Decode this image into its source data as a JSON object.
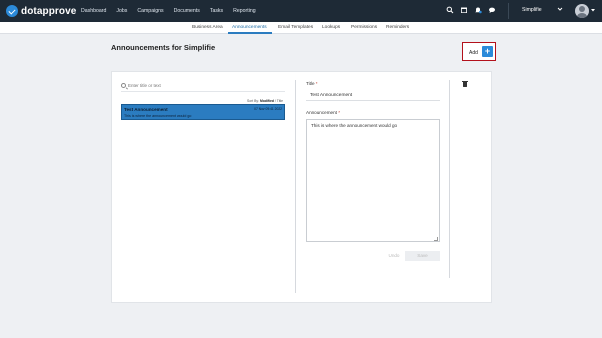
{
  "app": {
    "logo_text": "dotapprove",
    "nav": [
      "Dashboard",
      "Jobs",
      "Campaigns",
      "Documents",
      "Tasks",
      "Reporting"
    ],
    "org_name": "Simplifie"
  },
  "tabs": [
    {
      "label": "Business Area",
      "active": false
    },
    {
      "label": "Announcements",
      "active": true
    },
    {
      "label": "Email Templates",
      "active": false
    },
    {
      "label": "Lookups",
      "active": false
    },
    {
      "label": "Permissions",
      "active": false
    },
    {
      "label": "Reminders",
      "active": false
    }
  ],
  "page": {
    "title": "Announcements for Simplifie",
    "add_label": "Add",
    "add_icon": "+"
  },
  "list": {
    "search_placeholder": "Enter title or text",
    "sort_prefix": "Sort By:",
    "sort_modified": "Modified",
    "sort_sep": "/",
    "sort_title": "Title",
    "items": [
      {
        "title": "Test Announcement",
        "text": "This is where the announcement would go",
        "date": "07 Nov 09:41 2022"
      }
    ]
  },
  "editor": {
    "title_label": "Title",
    "title_value": "Test Announcement",
    "announcement_label": "Announcement",
    "announcement_value": "This is where the announcement would go",
    "required_mark": "*",
    "undo_label": "Undo",
    "save_label": "Save"
  },
  "icons": [
    "search-icon",
    "calendar-icon",
    "bell-icon",
    "chat-icon",
    "chevron-down-icon",
    "avatar",
    "plus-icon",
    "trash-icon"
  ],
  "colors": {
    "navbar": "#1e2a36",
    "accent": "#2b8ad9",
    "selected_row": "#2b7cc0",
    "highlight_border": "#b3111b"
  }
}
